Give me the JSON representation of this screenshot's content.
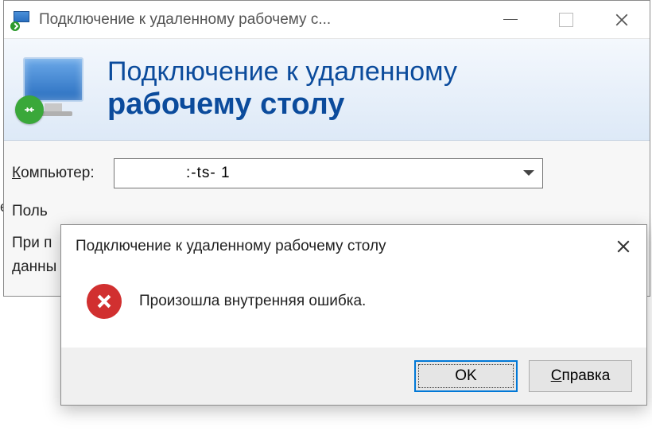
{
  "titlebar": {
    "title": "Подключение к удаленному рабочему с..."
  },
  "banner": {
    "line1": "Подключение к удаленному",
    "line2": "рабочему столу"
  },
  "form": {
    "computer_label_pre": "К",
    "computer_label_rest": "омпьютер:",
    "computer_value": ":-ts-        1",
    "user_label_truncated": "Поль",
    "hint_line1_truncated": "При п",
    "hint_line2_truncated": "данны"
  },
  "modal": {
    "title": "Подключение к удаленному рабочему столу",
    "message": "Произошла внутренняя ошибка.",
    "ok_label": "OK",
    "help_label_pre": "С",
    "help_label_rest": "правка"
  }
}
